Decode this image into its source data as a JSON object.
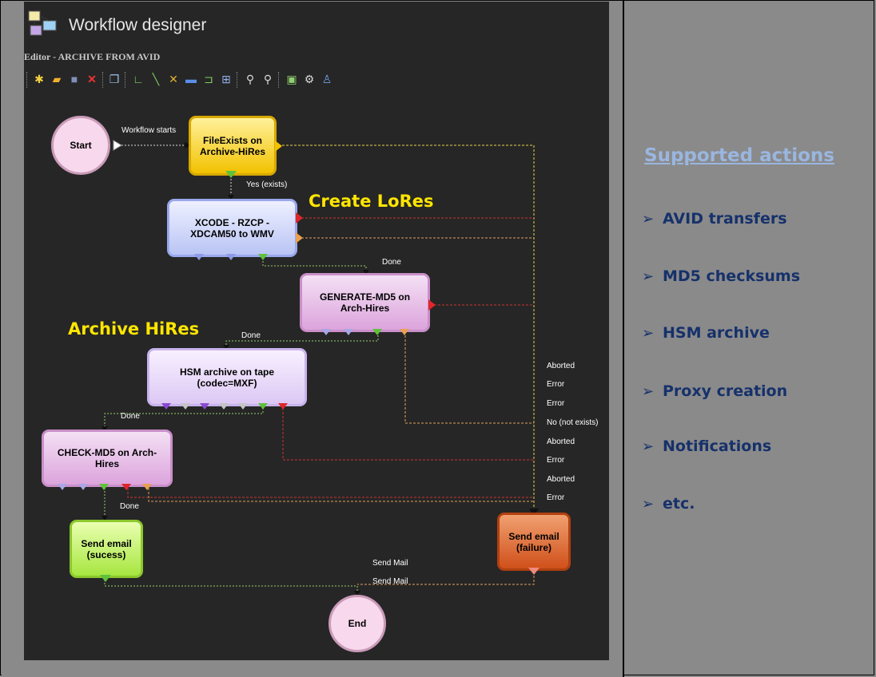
{
  "app": {
    "title": "Workflow designer",
    "editor_label": "Editor - ARCHIVE FROM AVID"
  },
  "toolbar": {
    "items": [
      "new-icon",
      "open-icon",
      "save-icon",
      "delete-icon",
      "copy-icon",
      "connector-icon",
      "line-icon",
      "cross-icon",
      "rectangle-icon",
      "route-icon",
      "layout-icon",
      "zoom-in-icon",
      "zoom-out-icon",
      "validate-icon",
      "settings-icon",
      "hierarchy-icon"
    ]
  },
  "nodes": {
    "start": "Start",
    "file_exists": [
      "FileExists on",
      "Archive-HiRes"
    ],
    "xcode": [
      "XCODE - RZCP -",
      "XDCAM50 to WMV"
    ],
    "generate_md5": [
      "GENERATE-MD5 on",
      "Arch-Hires"
    ],
    "hsm": [
      "HSM archive on tape",
      "(codec=MXF)"
    ],
    "check_md5": [
      "CHECK-MD5 on Arch-",
      "Hires"
    ],
    "email_success": [
      "Send email",
      "(sucess)"
    ],
    "email_failure": [
      "Send email",
      "(failure)"
    ],
    "end": "End"
  },
  "connection_labels": {
    "workflow_starts": "Workflow starts",
    "yes_exists": "Yes (exists)",
    "done": "Done",
    "send_mail": "Send Mail",
    "aborted": "Aborted",
    "error": "Error",
    "no_not_exists": "No (not exists)"
  },
  "annotations": {
    "create_lores": "Create LoRes",
    "archive_hires": "Archive HiRes"
  },
  "sidebar": {
    "title": "Supported actions",
    "items": [
      "AVID transfers",
      "MD5 checksums",
      "HSM archive",
      "Proxy creation",
      "Notifications",
      "etc."
    ]
  },
  "colors": {
    "annotation": "#ffe600",
    "sidebar_title": "#9ab6e0",
    "sidebar_text": "#16316b"
  }
}
